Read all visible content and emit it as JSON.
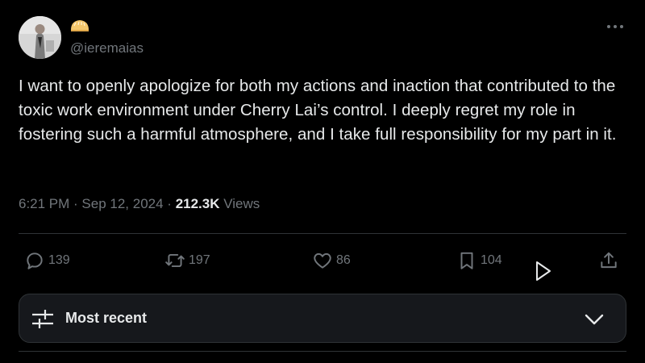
{
  "author": {
    "handle": "@ieremaias",
    "avatar_icon": "profile-photo",
    "name_icon": "emoji-badge"
  },
  "tweet": {
    "text": "I want to openly apologize for both my actions and inaction that contributed to the toxic work environment under Cherry Lai’s control. I deeply regret my role in fostering such a harmful atmosphere, and I take full responsibility for my part in it.",
    "time": "6:21 PM",
    "date": "Sep 12, 2024",
    "separator": " · ",
    "views_count": "212.3K",
    "views_label": " Views"
  },
  "actions": {
    "replies": "139",
    "reposts": "197",
    "likes": "86",
    "bookmarks": "104"
  },
  "sort": {
    "label": "Most recent"
  },
  "colors": {
    "background": "#000000",
    "text": "#e7e9ea",
    "secondary": "#71767b",
    "border": "#2f3336"
  }
}
